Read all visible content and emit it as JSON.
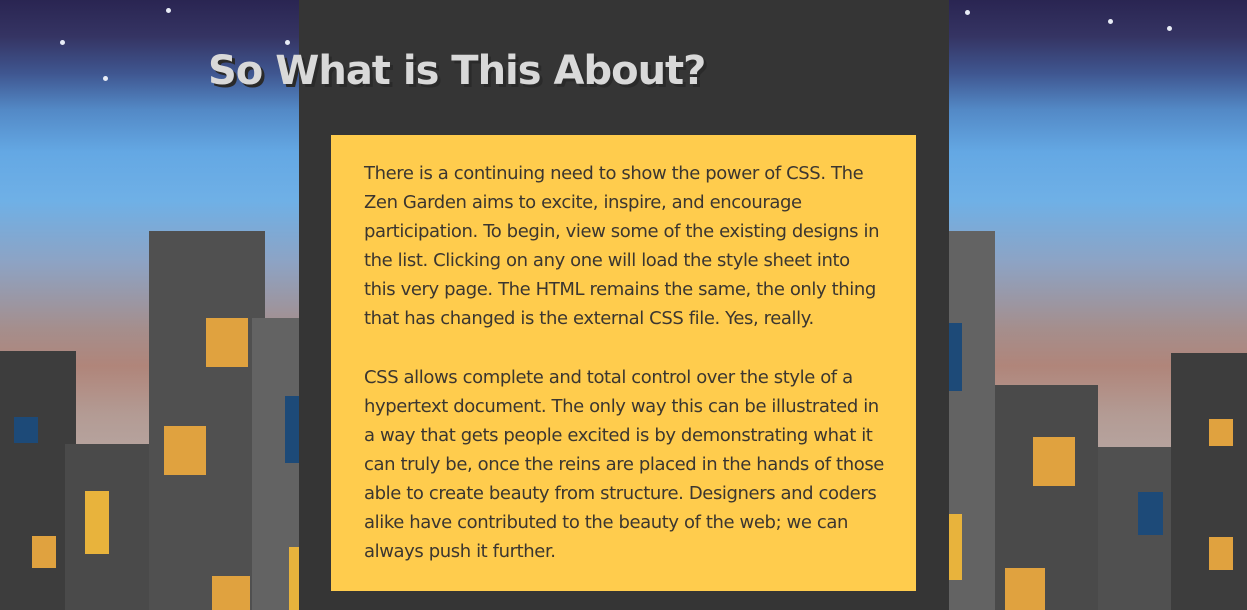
{
  "section": {
    "heading": "So What is This About?",
    "paragraphs": [
      "There is a continuing need to show the power of CSS. The Zen Garden aims to excite, inspire, and encourage participation. To begin, view some of the existing designs in the list. Clicking on any one will load the style sheet into this very page. The HTML remains the same, the only thing that has changed is the external CSS file. Yes, really.",
      "CSS allows complete and total control over the style of a hypertext document. The only way this can be illustrated in a way that gets people excited is by demonstrating what it can truly be, once the reins are placed in the hands of those able to create beauty from structure. Designers and coders alike have contributed to the beauty of the web; we can always push it further."
    ]
  },
  "colors": {
    "panel": "#353535",
    "card": "#ffcc4d",
    "heading": "#d9d9d9",
    "body_text": "#3b3630",
    "window_orange": "#e0a23f",
    "window_blue": "#1d4a78"
  }
}
